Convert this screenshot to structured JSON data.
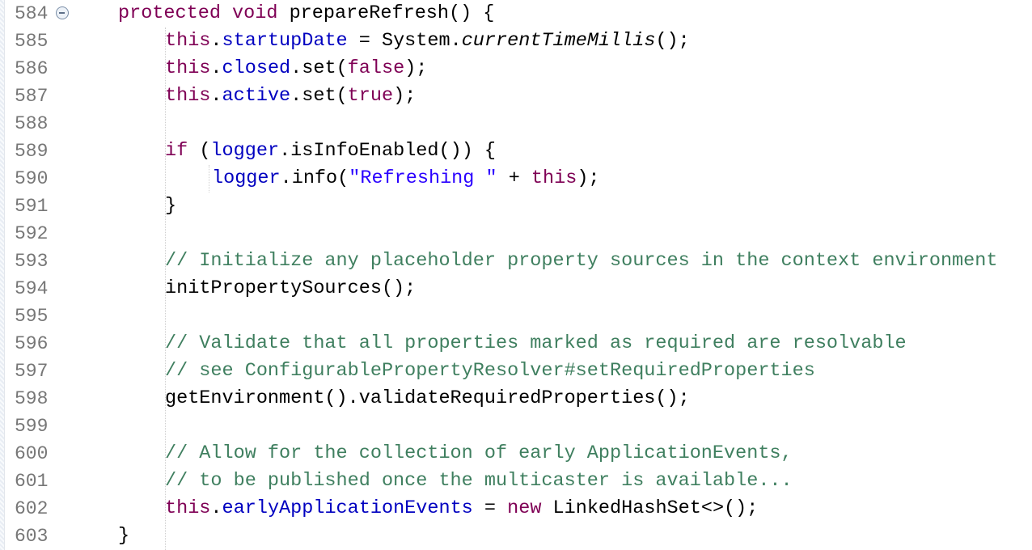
{
  "line_numbers": [
    "584",
    "585",
    "586",
    "587",
    "588",
    "589",
    "590",
    "591",
    "592",
    "593",
    "594",
    "595",
    "596",
    "597",
    "598",
    "599",
    "600",
    "601",
    "602",
    "603"
  ],
  "tokens": {
    "l584": {
      "protected": "protected",
      "void": "void",
      "method": "prepareRefresh() {"
    },
    "l585": {
      "this": "this",
      "dot": ".",
      "field": "startupDate",
      "rest1": " = System.",
      "italic": "currentTimeMillis",
      "rest2": "();"
    },
    "l586": {
      "this": "this",
      "dot": ".",
      "field": "closed",
      "rest1": ".set(",
      "false": "false",
      "rest2": ");"
    },
    "l587": {
      "this": "this",
      "dot": ".",
      "field": "active",
      "rest1": ".set(",
      "true": "true",
      "rest2": ");"
    },
    "l589": {
      "if": "if",
      "rest1": " (",
      "field": "logger",
      "rest2": ".isInfoEnabled()) {"
    },
    "l590": {
      "field": "logger",
      "rest1": ".info(",
      "str": "\"Refreshing \"",
      "rest2": " + ",
      "this": "this",
      "rest3": ");"
    },
    "l591": {
      "brace": "}"
    },
    "l593": {
      "comment": "// Initialize any placeholder property sources in the context environment"
    },
    "l594": {
      "code": "initPropertySources();"
    },
    "l596": {
      "comment": "// Validate that all properties marked as required are resolvable"
    },
    "l597": {
      "comment": "// see ConfigurablePropertyResolver#setRequiredProperties"
    },
    "l598": {
      "code": "getEnvironment().validateRequiredProperties();"
    },
    "l600": {
      "comment": "// Allow for the collection of early ApplicationEvents,"
    },
    "l601": {
      "comment": "// to be published once the multicaster is available..."
    },
    "l602": {
      "this": "this",
      "dot": ".",
      "field": "earlyApplicationEvents",
      "rest1": " = ",
      "new": "new",
      "rest2": " LinkedHashSet<>();"
    },
    "l603": {
      "brace": "}"
    }
  },
  "colors": {
    "keyword": "#7f0055",
    "field": "#0000c0",
    "string": "#2a00ff",
    "comment": "#3f7f5f",
    "line_number": "#777777",
    "background": "#ffffff"
  },
  "icons": {
    "fold": "collapse-fold-icon"
  }
}
